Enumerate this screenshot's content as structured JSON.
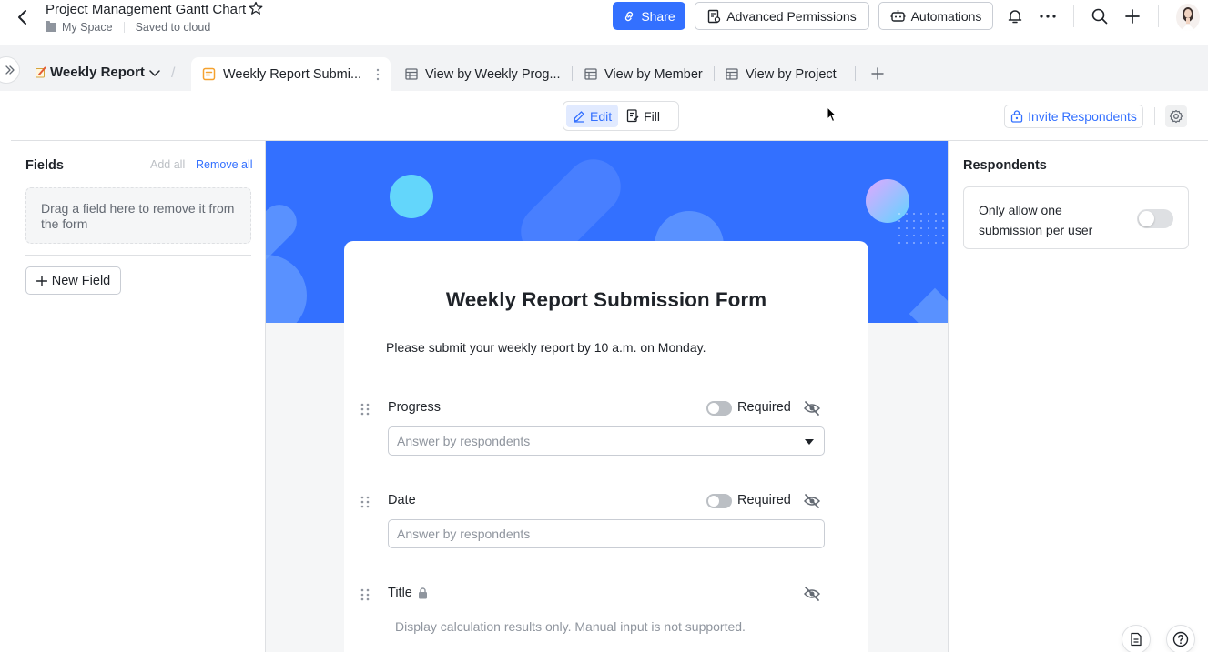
{
  "header": {
    "title": "Project Management Gantt Chart",
    "location": "My Space",
    "save_status": "Saved to cloud",
    "share_label": "Share",
    "advanced_permissions_label": "Advanced Permissions",
    "automations_label": "Automations",
    "accent_color": "#3370ff"
  },
  "tabs": {
    "group_label": "Weekly Report",
    "items": [
      {
        "label": "Weekly Report Submi...",
        "icon": "form-icon",
        "active": true
      },
      {
        "label": "View by Weekly Prog...",
        "icon": "grid-icon",
        "active": false
      },
      {
        "label": "View by Member",
        "icon": "grid-icon",
        "active": false
      },
      {
        "label": "View by Project",
        "icon": "grid-icon",
        "active": false
      }
    ]
  },
  "toolbar": {
    "edit_label": "Edit",
    "fill_label": "Fill",
    "invite_label": "Invite Respondents"
  },
  "fields_panel": {
    "title": "Fields",
    "add_all": "Add all",
    "remove_all": "Remove all",
    "drop_hint": "Drag a field here to remove it from the form",
    "new_field": "New Field"
  },
  "form": {
    "title": "Weekly Report Submission Form",
    "description": "Please submit your weekly report by 10 a.m. on Monday.",
    "required_label": "Required",
    "fields": [
      {
        "label": "Progress",
        "placeholder": "Answer by respondents",
        "type": "select",
        "required": false
      },
      {
        "label": "Date",
        "placeholder": "Answer by respondents",
        "type": "date",
        "required": false
      },
      {
        "label": "Title",
        "note": "Display calculation results only. Manual input is not supported.",
        "type": "formula",
        "locked": true
      }
    ]
  },
  "respondents": {
    "title": "Respondents",
    "one_submission_label": "Only allow one submission per user",
    "one_submission_enabled": false
  }
}
